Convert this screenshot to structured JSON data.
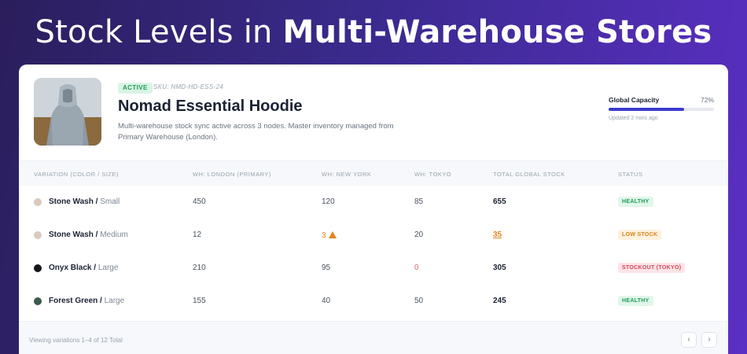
{
  "banner": {
    "title_light": "Stock Levels in ",
    "title_bold": "Multi-Warehouse Stores"
  },
  "product": {
    "status_badge": "ACTIVE",
    "sku": "SKU: NMD-HD-ESS-24",
    "name": "Nomad Essential Hoodie",
    "description": "Multi-warehouse stock sync active across 3 nodes. Master inventory managed from Primary Warehouse (London)."
  },
  "capacity": {
    "label": "Global Capacity",
    "value_text": "72%",
    "fraction": 0.72,
    "updated": "Updated 2 mins ago"
  },
  "table": {
    "headers": [
      "VARIATION (COLOR / SIZE)",
      "WH: LONDON (PRIMARY)",
      "WH: NEW YORK",
      "WH: TOKYO",
      "TOTAL GLOBAL STOCK",
      "STATUS"
    ],
    "rows": [
      {
        "color_name": "Stone Wash",
        "sep": " / ",
        "size": "Small",
        "swatch": "#d9cbbd",
        "london": "450",
        "new_york": "120",
        "tokyo": "85",
        "total": "655",
        "status": "HEALTHY",
        "status_kind": "healthy",
        "ny_warn": false,
        "tokyo_zero": false,
        "total_warn": false
      },
      {
        "color_name": "Stone Wash",
        "sep": " / ",
        "size": "Medium",
        "swatch": "#d9cbbd",
        "london": "12",
        "new_york": "3",
        "tokyo": "20",
        "total": "35",
        "status": "LOW STOCK",
        "status_kind": "low",
        "ny_warn": true,
        "tokyo_zero": false,
        "total_warn": true
      },
      {
        "color_name": "Onyx Black",
        "sep": " / ",
        "size": "Large",
        "swatch": "#14161a",
        "london": "210",
        "new_york": "95",
        "tokyo": "0",
        "total": "305",
        "status": "STOCKOUT (TOKYO)",
        "status_kind": "out",
        "ny_warn": false,
        "tokyo_zero": true,
        "total_warn": false
      },
      {
        "color_name": "Forest Green",
        "sep": " / ",
        "size": "Large",
        "swatch": "#3f5a4d",
        "london": "155",
        "new_york": "40",
        "tokyo": "50",
        "total": "245",
        "status": "HEALTHY",
        "status_kind": "healthy",
        "ny_warn": false,
        "tokyo_zero": false,
        "total_warn": false
      }
    ]
  },
  "footer": {
    "text": "Viewing variations 1–4 of 12 Total",
    "prev": "‹",
    "next": "›"
  },
  "colors": {
    "accent": "#3c3ccf",
    "healthy": "#1f9d55",
    "warning": "#e0861a",
    "danger": "#d6455a"
  }
}
